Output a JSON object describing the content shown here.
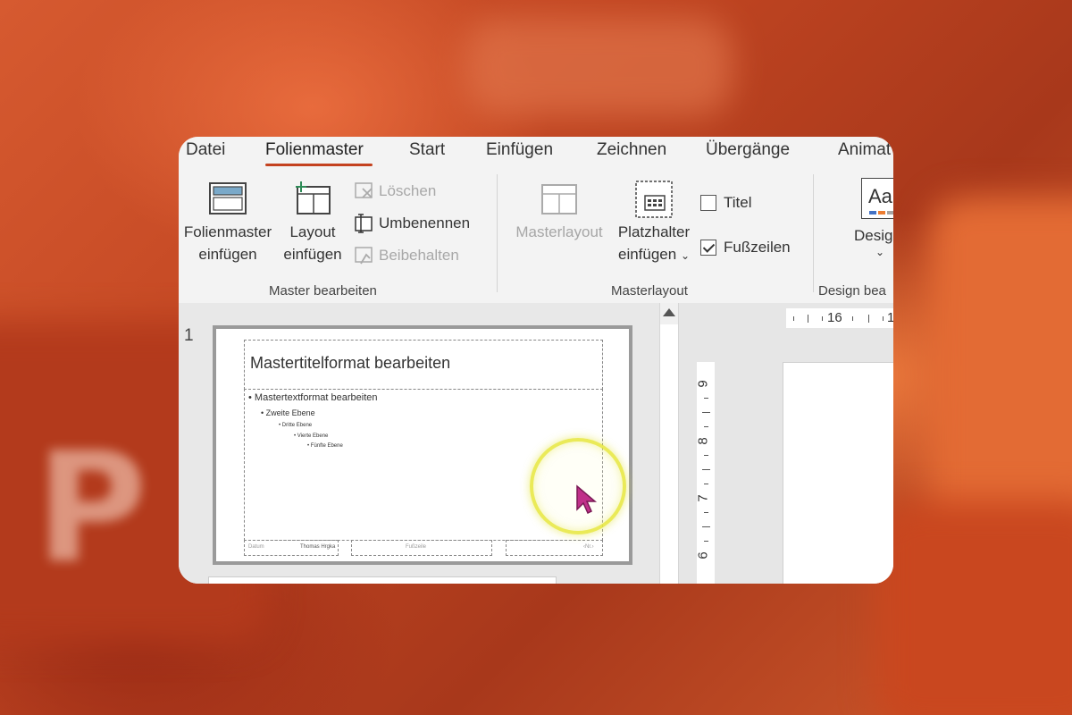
{
  "tabs": [
    {
      "label": "Datei"
    },
    {
      "label": "Folienmaster"
    },
    {
      "label": "Start"
    },
    {
      "label": "Einfügen"
    },
    {
      "label": "Zeichnen"
    },
    {
      "label": "Übergänge"
    },
    {
      "label": "Animat"
    }
  ],
  "ribbon": {
    "master_group": {
      "insert_master_l1": "Folienmaster",
      "insert_master_l2": "einfügen",
      "insert_layout_l1": "Layout",
      "insert_layout_l2": "einfügen",
      "delete": "Löschen",
      "rename": "Umbenennen",
      "preserve": "Beibehalten",
      "label": "Master bearbeiten"
    },
    "layout_group": {
      "masterlayout": "Masterlayout",
      "placeholder_l1": "Platzhalter",
      "placeholder_l2": "einfügen",
      "title_check": "Titel",
      "footer_check": "Fußzeilen",
      "label": "Masterlayout"
    },
    "design_group": {
      "design_button": "Desig",
      "label": "Design bea",
      "aa_glyph": "Aa"
    }
  },
  "slides": {
    "number": "1",
    "title_text": "Mastertitelformat bearbeiten",
    "levels": [
      "Mastertextformat bearbeiten",
      "Zweite Ebene",
      "Dritte Ebene",
      "Vierte Ebene",
      "Fünfte Ebene"
    ],
    "footer": {
      "date": "Datum",
      "center": "Thomas Hrgka",
      "right_label": "Fußzeile",
      "page": "‹Nr.›"
    }
  },
  "rulers": {
    "h_num1": "16",
    "h_num2": "1",
    "v_nums": [
      "9",
      "8",
      "7",
      "6"
    ]
  },
  "background": {
    "logo_letter": "P"
  },
  "colors": {
    "accent": "#c4421f",
    "background": "#b8401e",
    "cursor": "#c0308a"
  }
}
